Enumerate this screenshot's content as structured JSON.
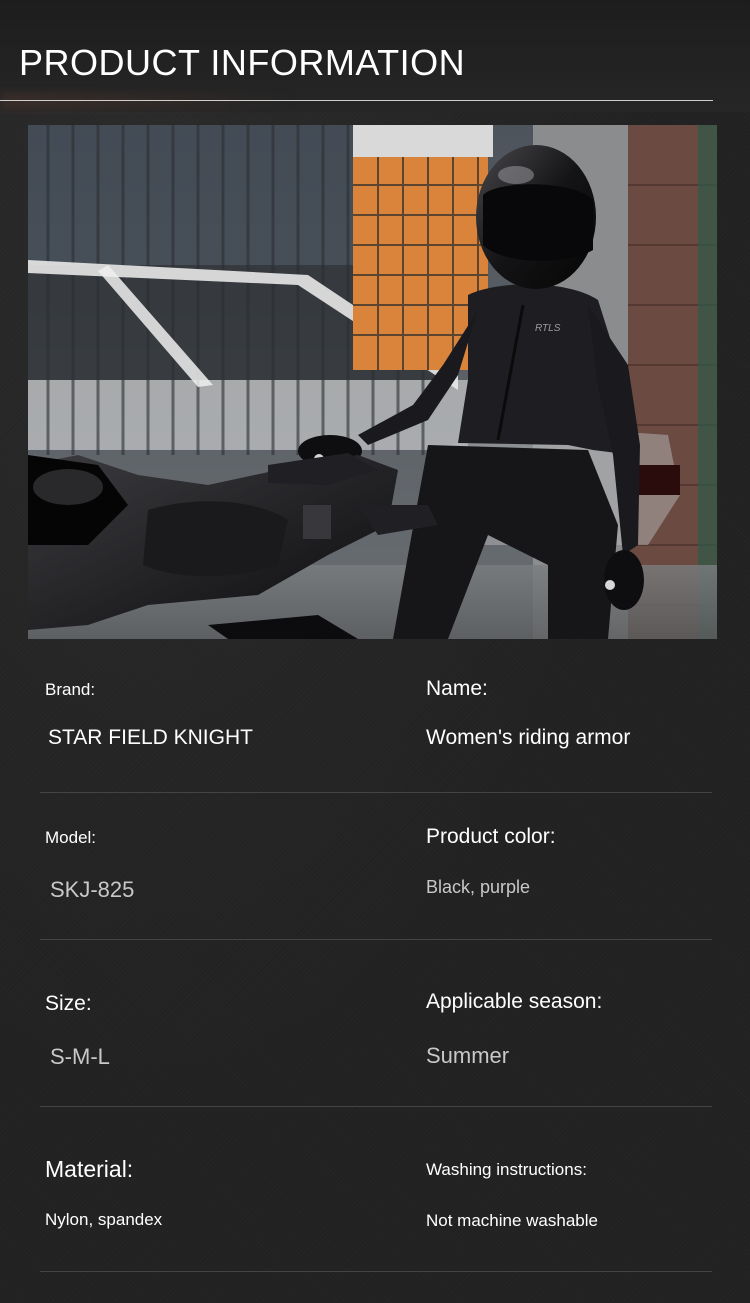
{
  "header": {
    "title": "PRODUCT INFORMATION"
  },
  "photo": {
    "jacket_logo": "RTLS"
  },
  "specs": [
    {
      "label": "Brand:",
      "value": "STAR FIELD KNIGHT"
    },
    {
      "label": "Name:",
      "value": "Women's riding armor"
    },
    {
      "label": "Model:",
      "value": "SKJ-825"
    },
    {
      "label": "Product color:",
      "value": "Black, purple"
    },
    {
      "label": "Size:",
      "value": "S-M-L"
    },
    {
      "label": "Applicable season:",
      "value": "Summer"
    },
    {
      "label": "Material:",
      "value": "Nylon, spandex"
    },
    {
      "label": "Washing instructions:",
      "value": "Not machine washable"
    }
  ],
  "colors": {
    "background": "#222222",
    "title": "#ffffff",
    "rule": "#cfcfcf",
    "divider": "#444444",
    "value_grey": "#c8c8c8"
  }
}
